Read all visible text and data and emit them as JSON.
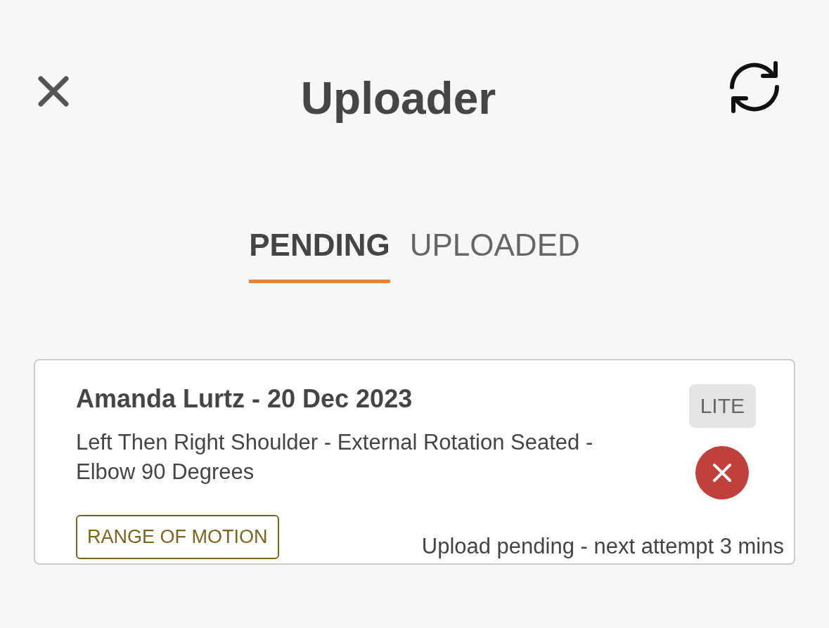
{
  "header": {
    "title": "Uploader"
  },
  "tabs": [
    {
      "label": "PENDING",
      "selected": true
    },
    {
      "label": "UPLOADED",
      "selected": false
    }
  ],
  "uploads": [
    {
      "title": "Amanda Lurtz - 20 Dec 2023",
      "description": "Left Then Right Shoulder - External Rotation Seated - Elbow 90 Degrees",
      "tag": "RANGE OF MOTION",
      "badge": "LITE",
      "status": "Upload pending - next attempt 3 mins"
    }
  ]
}
